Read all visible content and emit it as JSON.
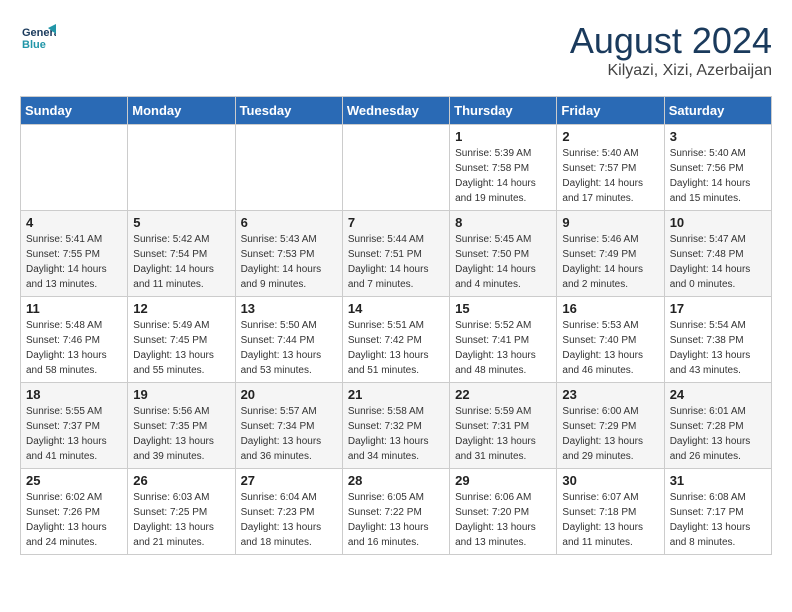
{
  "header": {
    "logo_line1": "General",
    "logo_line2": "Blue",
    "month": "August 2024",
    "location": "Kilyazi, Xizi, Azerbaijan"
  },
  "weekdays": [
    "Sunday",
    "Monday",
    "Tuesday",
    "Wednesday",
    "Thursday",
    "Friday",
    "Saturday"
  ],
  "weeks": [
    [
      {
        "day": "",
        "info": ""
      },
      {
        "day": "",
        "info": ""
      },
      {
        "day": "",
        "info": ""
      },
      {
        "day": "",
        "info": ""
      },
      {
        "day": "1",
        "info": "Sunrise: 5:39 AM\nSunset: 7:58 PM\nDaylight: 14 hours\nand 19 minutes."
      },
      {
        "day": "2",
        "info": "Sunrise: 5:40 AM\nSunset: 7:57 PM\nDaylight: 14 hours\nand 17 minutes."
      },
      {
        "day": "3",
        "info": "Sunrise: 5:40 AM\nSunset: 7:56 PM\nDaylight: 14 hours\nand 15 minutes."
      }
    ],
    [
      {
        "day": "4",
        "info": "Sunrise: 5:41 AM\nSunset: 7:55 PM\nDaylight: 14 hours\nand 13 minutes."
      },
      {
        "day": "5",
        "info": "Sunrise: 5:42 AM\nSunset: 7:54 PM\nDaylight: 14 hours\nand 11 minutes."
      },
      {
        "day": "6",
        "info": "Sunrise: 5:43 AM\nSunset: 7:53 PM\nDaylight: 14 hours\nand 9 minutes."
      },
      {
        "day": "7",
        "info": "Sunrise: 5:44 AM\nSunset: 7:51 PM\nDaylight: 14 hours\nand 7 minutes."
      },
      {
        "day": "8",
        "info": "Sunrise: 5:45 AM\nSunset: 7:50 PM\nDaylight: 14 hours\nand 4 minutes."
      },
      {
        "day": "9",
        "info": "Sunrise: 5:46 AM\nSunset: 7:49 PM\nDaylight: 14 hours\nand 2 minutes."
      },
      {
        "day": "10",
        "info": "Sunrise: 5:47 AM\nSunset: 7:48 PM\nDaylight: 14 hours\nand 0 minutes."
      }
    ],
    [
      {
        "day": "11",
        "info": "Sunrise: 5:48 AM\nSunset: 7:46 PM\nDaylight: 13 hours\nand 58 minutes."
      },
      {
        "day": "12",
        "info": "Sunrise: 5:49 AM\nSunset: 7:45 PM\nDaylight: 13 hours\nand 55 minutes."
      },
      {
        "day": "13",
        "info": "Sunrise: 5:50 AM\nSunset: 7:44 PM\nDaylight: 13 hours\nand 53 minutes."
      },
      {
        "day": "14",
        "info": "Sunrise: 5:51 AM\nSunset: 7:42 PM\nDaylight: 13 hours\nand 51 minutes."
      },
      {
        "day": "15",
        "info": "Sunrise: 5:52 AM\nSunset: 7:41 PM\nDaylight: 13 hours\nand 48 minutes."
      },
      {
        "day": "16",
        "info": "Sunrise: 5:53 AM\nSunset: 7:40 PM\nDaylight: 13 hours\nand 46 minutes."
      },
      {
        "day": "17",
        "info": "Sunrise: 5:54 AM\nSunset: 7:38 PM\nDaylight: 13 hours\nand 43 minutes."
      }
    ],
    [
      {
        "day": "18",
        "info": "Sunrise: 5:55 AM\nSunset: 7:37 PM\nDaylight: 13 hours\nand 41 minutes."
      },
      {
        "day": "19",
        "info": "Sunrise: 5:56 AM\nSunset: 7:35 PM\nDaylight: 13 hours\nand 39 minutes."
      },
      {
        "day": "20",
        "info": "Sunrise: 5:57 AM\nSunset: 7:34 PM\nDaylight: 13 hours\nand 36 minutes."
      },
      {
        "day": "21",
        "info": "Sunrise: 5:58 AM\nSunset: 7:32 PM\nDaylight: 13 hours\nand 34 minutes."
      },
      {
        "day": "22",
        "info": "Sunrise: 5:59 AM\nSunset: 7:31 PM\nDaylight: 13 hours\nand 31 minutes."
      },
      {
        "day": "23",
        "info": "Sunrise: 6:00 AM\nSunset: 7:29 PM\nDaylight: 13 hours\nand 29 minutes."
      },
      {
        "day": "24",
        "info": "Sunrise: 6:01 AM\nSunset: 7:28 PM\nDaylight: 13 hours\nand 26 minutes."
      }
    ],
    [
      {
        "day": "25",
        "info": "Sunrise: 6:02 AM\nSunset: 7:26 PM\nDaylight: 13 hours\nand 24 minutes."
      },
      {
        "day": "26",
        "info": "Sunrise: 6:03 AM\nSunset: 7:25 PM\nDaylight: 13 hours\nand 21 minutes."
      },
      {
        "day": "27",
        "info": "Sunrise: 6:04 AM\nSunset: 7:23 PM\nDaylight: 13 hours\nand 18 minutes."
      },
      {
        "day": "28",
        "info": "Sunrise: 6:05 AM\nSunset: 7:22 PM\nDaylight: 13 hours\nand 16 minutes."
      },
      {
        "day": "29",
        "info": "Sunrise: 6:06 AM\nSunset: 7:20 PM\nDaylight: 13 hours\nand 13 minutes."
      },
      {
        "day": "30",
        "info": "Sunrise: 6:07 AM\nSunset: 7:18 PM\nDaylight: 13 hours\nand 11 minutes."
      },
      {
        "day": "31",
        "info": "Sunrise: 6:08 AM\nSunset: 7:17 PM\nDaylight: 13 hours\nand 8 minutes."
      }
    ]
  ]
}
